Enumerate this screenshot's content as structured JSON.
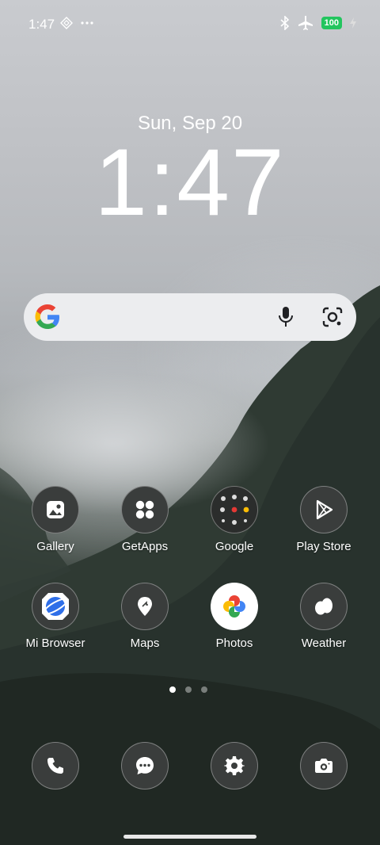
{
  "status_bar": {
    "time": "1:47",
    "battery": "100"
  },
  "clock": {
    "date": "Sun, Sep 20",
    "time": "1:47"
  },
  "search": {
    "icons": [
      "google-logo",
      "mic-icon",
      "google-lens-icon"
    ]
  },
  "apps_row1": [
    {
      "label": "Gallery",
      "icon": "gallery-icon"
    },
    {
      "label": "GetApps",
      "icon": "getapps-icon"
    },
    {
      "label": "Google",
      "icon": "google-folder-icon"
    },
    {
      "label": "Play Store",
      "icon": "play-store-icon"
    }
  ],
  "apps_row2": [
    {
      "label": "Mi Browser",
      "icon": "mi-browser-icon"
    },
    {
      "label": "Maps",
      "icon": "maps-icon"
    },
    {
      "label": "Photos",
      "icon": "photos-icon"
    },
    {
      "label": "Weather",
      "icon": "weather-icon"
    }
  ],
  "page_indicator": {
    "pages": 3,
    "current": 1
  },
  "dock": [
    "phone-icon",
    "messages-icon",
    "settings-icon",
    "camera-icon"
  ],
  "colors": {
    "battery": "#22c55e",
    "search_bg": "#ecedef"
  }
}
